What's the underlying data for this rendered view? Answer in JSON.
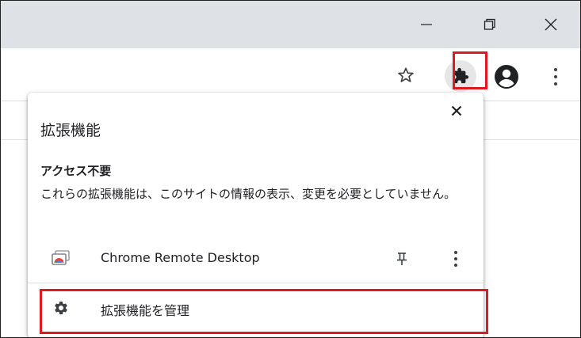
{
  "window": {
    "minimize_label": "Minimize",
    "maximize_label": "Maximize",
    "close_label": "Close"
  },
  "toolbar": {
    "bookmark_icon": "star-icon",
    "extensions_icon": "puzzle-icon",
    "profile_icon": "account-circle-icon",
    "menu_icon": "kebab-menu-icon"
  },
  "popup": {
    "title": "拡張機能",
    "section_title": "アクセス不要",
    "section_desc": "これらの拡張機能は、このサイトの情報の表示、変更を必要としていません。",
    "extensions": [
      {
        "name": "Chrome Remote Desktop",
        "icon": "chrome-remote-desktop-icon"
      }
    ],
    "manage_label": "拡張機能を管理"
  },
  "colors": {
    "titlebar": "#dee1e6",
    "highlight": "#e0191e",
    "icon": "#3c4043",
    "text": "#202124"
  }
}
